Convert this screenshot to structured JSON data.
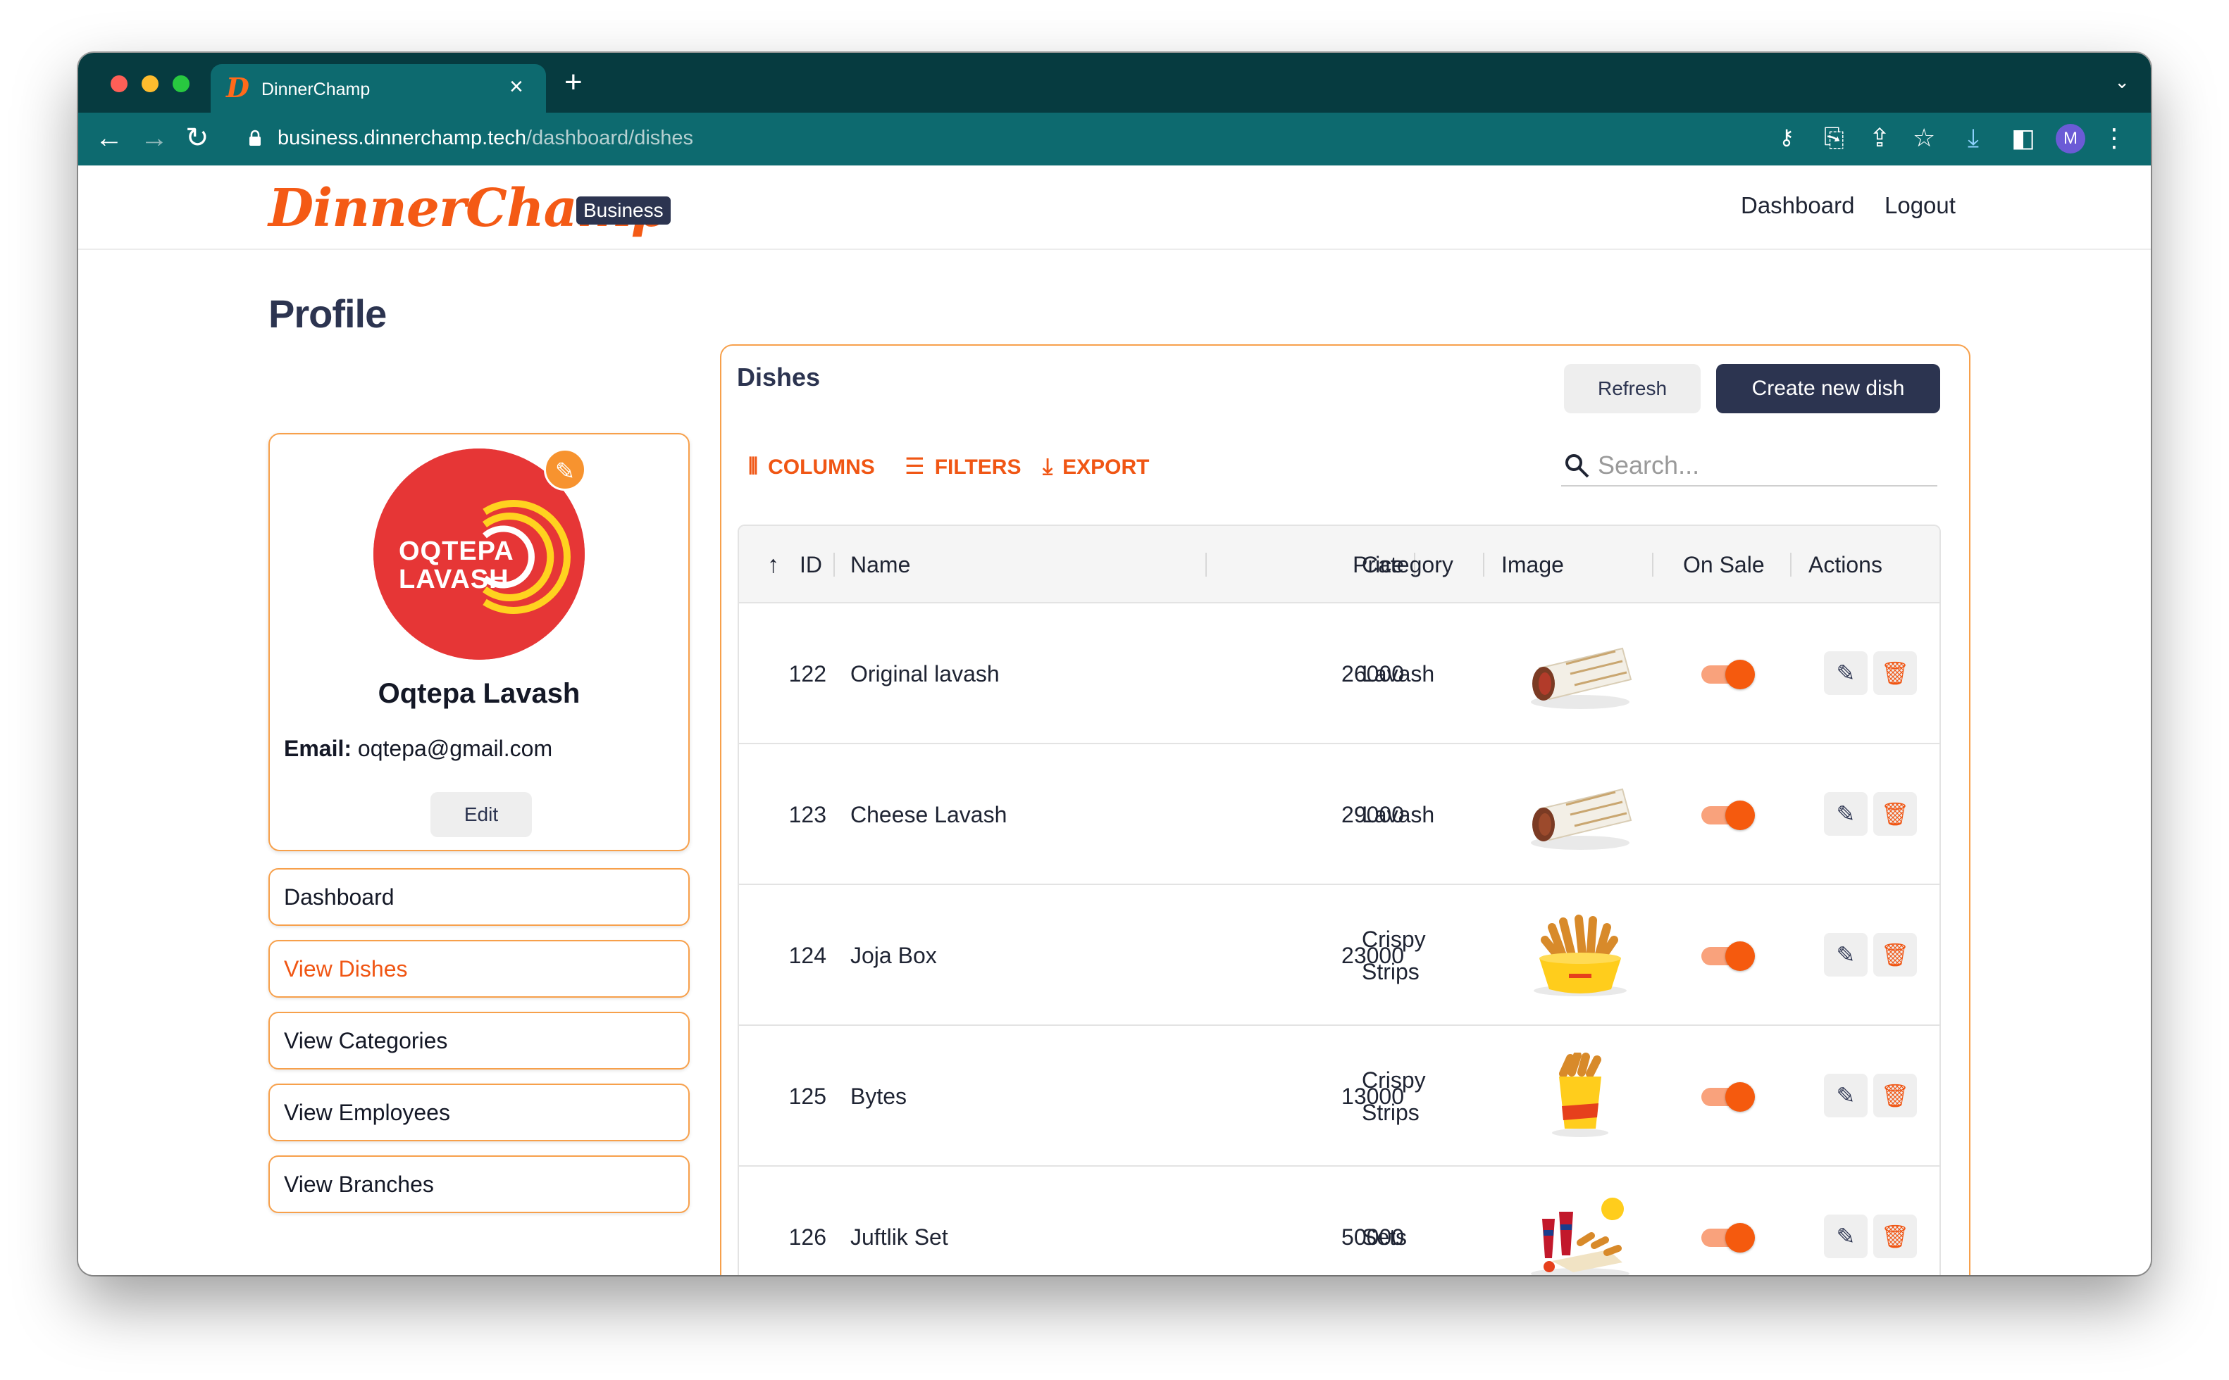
{
  "browser": {
    "tab_title": "DinnerChamp",
    "tab_favicon": "D",
    "url_domain": "business.dinnerchamp.tech",
    "url_path": "/dashboard/dishes",
    "profile_initial": "M"
  },
  "header": {
    "logo": "DinnerChamp",
    "badge": "Business",
    "nav": [
      "Dashboard",
      "Logout"
    ]
  },
  "page": {
    "title": "Profile"
  },
  "profile": {
    "avatar_line1": "OQTEPA",
    "avatar_line2": "LAVASH",
    "name": "Oqtepa Lavash",
    "email_label": "Email:",
    "email": "oqtepa@gmail.com",
    "edit_label": "Edit"
  },
  "sidebar": {
    "items": [
      {
        "label": "Dashboard",
        "active": false
      },
      {
        "label": "View Dishes",
        "active": true
      },
      {
        "label": "View Categories",
        "active": false
      },
      {
        "label": "View Employees",
        "active": false
      },
      {
        "label": "View Branches",
        "active": false
      }
    ]
  },
  "dishes": {
    "title": "Dishes",
    "refresh_label": "Refresh",
    "create_label": "Create new dish",
    "toolbar": {
      "columns": "COLUMNS",
      "filters": "FILTERS",
      "export": "EXPORT"
    },
    "search_placeholder": "Search...",
    "columns": [
      "ID",
      "Name",
      "Price",
      "Category",
      "Image",
      "On Sale",
      "Actions"
    ],
    "sort": {
      "column": "ID",
      "direction": "asc"
    },
    "rows": [
      {
        "id": "122",
        "name": "Original lavash",
        "price": "26000",
        "category": [
          "Lavash"
        ],
        "image": "lavash-wrap",
        "on_sale": true
      },
      {
        "id": "123",
        "name": "Cheese Lavash",
        "price": "29000",
        "category": [
          "Lavash"
        ],
        "image": "lavash-wrap",
        "on_sale": true
      },
      {
        "id": "124",
        "name": "Joja Box",
        "price": "23000",
        "category": [
          "Crispy",
          "Strips"
        ],
        "image": "chicken-box",
        "on_sale": true
      },
      {
        "id": "125",
        "name": "Bytes",
        "price": "13000",
        "category": [
          "Crispy",
          "Strips"
        ],
        "image": "chicken-cup",
        "on_sale": true
      },
      {
        "id": "126",
        "name": "Juftlik Set",
        "price": "50000",
        "category": [
          "Sets"
        ],
        "image": "combo-set",
        "on_sale": true
      }
    ]
  },
  "colors": {
    "brand": "#f45a15",
    "navy": "#2c3450",
    "border_accent": "#f7a04b",
    "chrome_dark": "#063b40",
    "chrome": "#0d6a6f"
  }
}
